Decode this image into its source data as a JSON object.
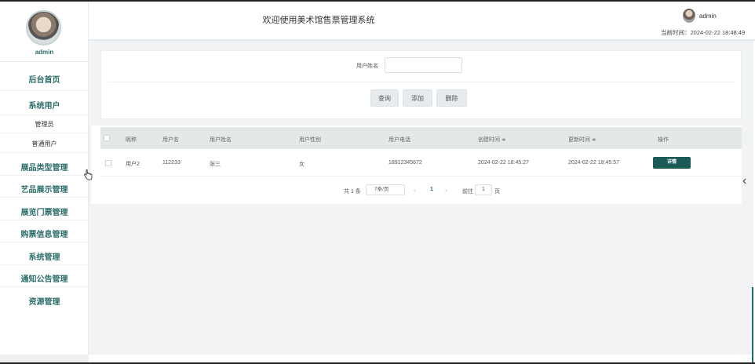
{
  "app": {
    "title": "欢迎使用美术馆售票管理系统"
  },
  "header": {
    "user_name": "admin",
    "current_time": "当前时间：2024-02-22 18:48:49"
  },
  "sidebar": {
    "user_name": "admin",
    "items": [
      {
        "label": "后台首页"
      },
      {
        "label": "系统用户"
      },
      {
        "label": "管理员"
      },
      {
        "label": "普通用户"
      },
      {
        "label": "展品类型管理"
      },
      {
        "label": "艺品展示管理"
      },
      {
        "label": "展览门票管理"
      },
      {
        "label": "购票信息管理"
      },
      {
        "label": "系统管理"
      },
      {
        "label": "通知公告管理"
      },
      {
        "label": "资源管理"
      }
    ]
  },
  "search": {
    "label": "用户姓名",
    "placeholder": "",
    "buttons": {
      "query": "查询",
      "add": "添加",
      "delete": "删除"
    }
  },
  "table": {
    "columns": [
      "昵称",
      "用户名",
      "用户姓名",
      "用户性别",
      "用户电话",
      "创建时间 ≑",
      "更新时间 ≑",
      "操作"
    ],
    "rows": [
      {
        "nickname": "用户2",
        "username": "112233",
        "realname": "张三",
        "gender": "女",
        "phone": "18912345672",
        "created": "2024-02-22 18:45:27",
        "updated": "2024-02-22 18:45:57",
        "action": "详情"
      }
    ]
  },
  "pagination": {
    "total": "共 1 条",
    "page_size": "7条/页",
    "prev": "‹",
    "current_page": "1",
    "next": "›",
    "goto_label": "前往",
    "goto_value": "1",
    "goto_unit": "页"
  },
  "colors": {
    "accent": "#2b6d6a",
    "detail_button": "#1c5a56",
    "table_header": "#e3e9e7"
  },
  "icons": {
    "collapse": "chevron-left-icon",
    "cursor": "hand-pointer-icon"
  }
}
